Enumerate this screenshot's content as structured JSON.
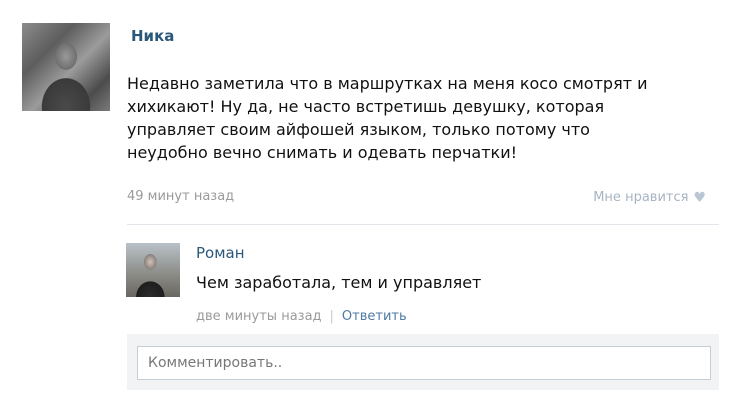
{
  "post": {
    "author": "Ника",
    "text": "Недавно заметила что в маршрутках на меня косо смотрят и\nхихикают! Ну да, не часто встретишь девушку, которая\nуправляет своим айфошей языком, только потому что\nнеудобно вечно снимать и одевать перчатки!",
    "time": "49 минут назад",
    "like_label": "Мне нравится"
  },
  "reply": {
    "author": "Роман",
    "text": "Чем заработала, тем и управляет",
    "time": "две минуты назад",
    "separator": "|",
    "reply_link": "Ответить"
  },
  "comment": {
    "placeholder": "Комментировать.."
  },
  "icons": {
    "like": "heart-icon"
  },
  "colors": {
    "link": "#2b587a",
    "muted": "#9a9a9a",
    "like": "#a8b4c2"
  }
}
